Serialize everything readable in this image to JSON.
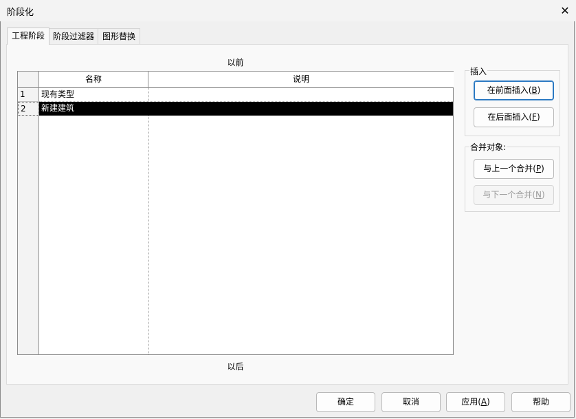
{
  "window": {
    "title": "阶段化"
  },
  "tabs": [
    {
      "label": "工程阶段",
      "active": true
    },
    {
      "label": "阶段过滤器",
      "active": false
    },
    {
      "label": "图形替换",
      "active": false
    }
  ],
  "phases": {
    "earlier_label": "以前",
    "later_label": "以后",
    "columns": {
      "name": "名称",
      "description": "说明"
    },
    "rows": [
      {
        "num": "1",
        "name": "现有类型",
        "description": ""
      },
      {
        "num": "2",
        "name": "新建建筑",
        "description": ""
      }
    ],
    "selected_row": 2
  },
  "insert_group": {
    "label": "插入",
    "before": {
      "text": "在前面插入(",
      "key": "B",
      "close": ")"
    },
    "after": {
      "text": "在后面插入(",
      "key": "F",
      "close": ")"
    }
  },
  "merge_group": {
    "label": "合并对象:",
    "prev": {
      "text": "与上一个合并(",
      "key": "P",
      "close": ")"
    },
    "next": {
      "text": "与下一个合并(",
      "key": "N",
      "close": ")"
    }
  },
  "footer": {
    "ok": "确定",
    "cancel": "取消",
    "apply": {
      "text": "应用(",
      "key": "A",
      "close": ")"
    },
    "help": "帮助"
  },
  "colors": {
    "accent": "#2b79c2",
    "selection": "#000000"
  }
}
